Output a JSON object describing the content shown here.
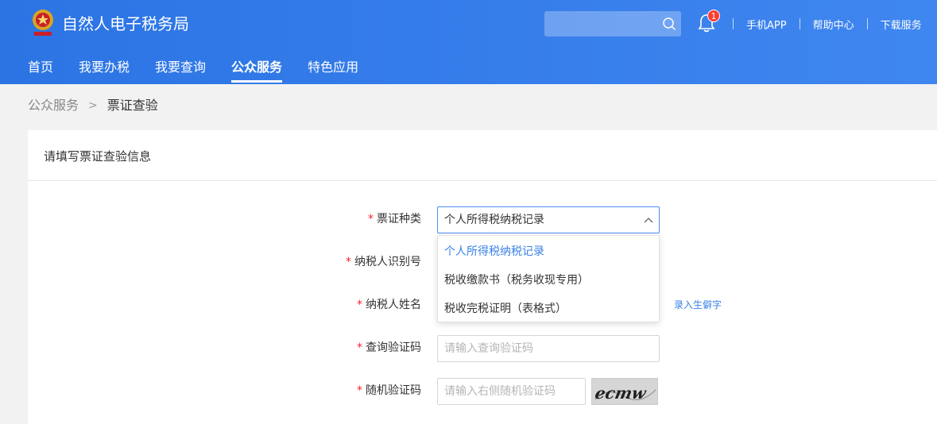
{
  "header": {
    "app_title": "自然人电子税务局",
    "search_placeholder": "",
    "notification_count": "1",
    "links": [
      "手机APP",
      "帮助中心",
      "下载服务"
    ]
  },
  "nav": {
    "items": [
      "首页",
      "我要办税",
      "我要查询",
      "公众服务",
      "特色应用"
    ],
    "active": "公众服务"
  },
  "breadcrumb": {
    "parent": "公众服务",
    "separator": ">",
    "current": "票证查验"
  },
  "panel": {
    "title": "请填写票证查验信息"
  },
  "form": {
    "required_mark": "*",
    "ticket_type": {
      "label": "票证种类",
      "value": "个人所得税纳税记录",
      "options": [
        "个人所得税纳税记录",
        "税收缴款书（税务收现专用）",
        "税收完税证明（表格式）"
      ]
    },
    "taxpayer_id": {
      "label": "纳税人识别号"
    },
    "taxpayer_name": {
      "label": "纳税人姓名",
      "rare_char_link": "录入生僻字"
    },
    "query_code": {
      "label": "查询验证码",
      "placeholder": "请输入查询验证码"
    },
    "random_code": {
      "label": "随机验证码",
      "placeholder": "请输入右侧随机验证码",
      "captcha_text": "ecmw"
    }
  },
  "colors": {
    "header_blue": "#3178e8",
    "link_blue": "#3b82e8",
    "required_red": "#f5222d",
    "badge_red": "#ff3b30"
  }
}
